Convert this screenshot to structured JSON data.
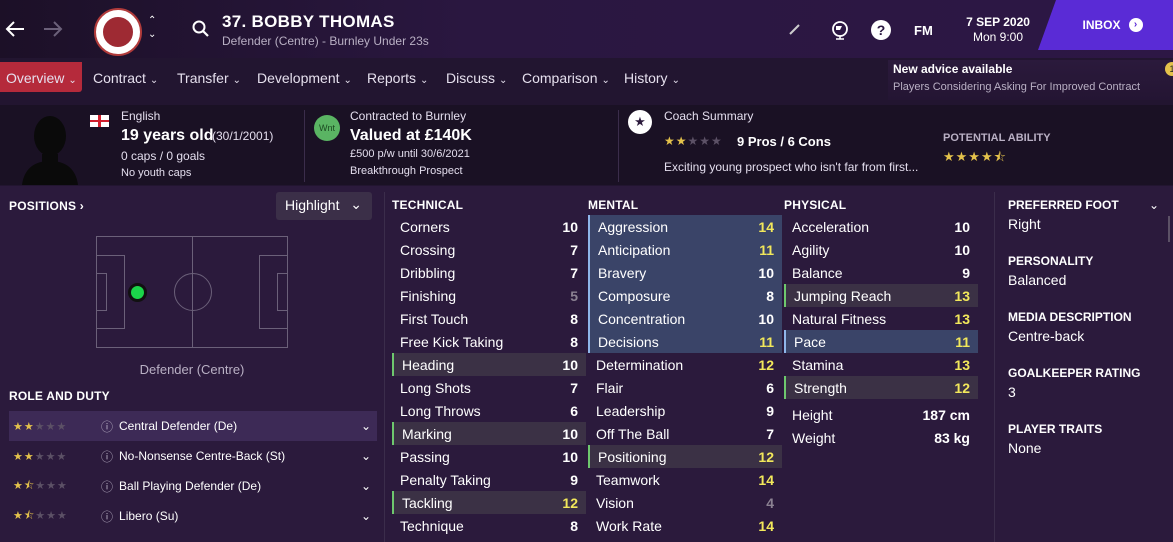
{
  "header": {
    "back_icon": "arrow-left-icon",
    "forward_icon": "arrow-right-icon",
    "player_name": "37. BOBBY THOMAS",
    "player_sub": "Defender (Centre) - Burnley Under 23s",
    "date": "7 SEP 2020",
    "time": "Mon 9:00",
    "fm_label": "FM",
    "inbox_label": "INBOX"
  },
  "menu": [
    {
      "label": "Overview"
    },
    {
      "label": "Contract"
    },
    {
      "label": "Transfer"
    },
    {
      "label": "Development"
    },
    {
      "label": "Reports"
    },
    {
      "label": "Discuss"
    },
    {
      "label": "Comparison"
    },
    {
      "label": "History"
    }
  ],
  "advice": {
    "title": "New advice available",
    "subtitle": "Players Considering Asking For Improved Contract",
    "count": "1"
  },
  "profile": {
    "nationality": "English",
    "age": "19 years old",
    "dob": "(30/1/2001)",
    "caps": "0 caps / 0 goals",
    "youth": "No youth caps"
  },
  "contract": {
    "badge": "Wnt",
    "title": "Contracted to Burnley",
    "value": "Valued at £140K",
    "wage": "£500 p/w until 30/6/2021",
    "status": "Breakthrough Prospect"
  },
  "coach": {
    "title": "Coach Summary",
    "pros_cons": "9 Pros / 6 Cons",
    "summary": "Exciting young prospect who isn't far from first...",
    "stars": 2
  },
  "potential": {
    "label": "POTENTIAL ABILITY",
    "stars": 4.5
  },
  "positions": {
    "title": "POSITIONS",
    "highlight": "Highlight",
    "position": "Defender (Centre)"
  },
  "roles": {
    "title": "ROLE AND DUTY",
    "items": [
      {
        "name": "Central Defender (De)",
        "stars": 2
      },
      {
        "name": "No-Nonsense Centre-Back (St)",
        "stars": 2
      },
      {
        "name": "Ball Playing Defender (De)",
        "stars": 1.5
      },
      {
        "name": "Libero (Su)",
        "stars": 1.5
      }
    ]
  },
  "technical": {
    "title": "TECHNICAL",
    "rows": [
      {
        "n": "Corners",
        "v": "10"
      },
      {
        "n": "Crossing",
        "v": "7"
      },
      {
        "n": "Dribbling",
        "v": "7"
      },
      {
        "n": "Finishing",
        "v": "5"
      },
      {
        "n": "First Touch",
        "v": "8"
      },
      {
        "n": "Free Kick Taking",
        "v": "8"
      },
      {
        "n": "Heading",
        "v": "10"
      },
      {
        "n": "Long Shots",
        "v": "7"
      },
      {
        "n": "Long Throws",
        "v": "6"
      },
      {
        "n": "Marking",
        "v": "10"
      },
      {
        "n": "Passing",
        "v": "10"
      },
      {
        "n": "Penalty Taking",
        "v": "9"
      },
      {
        "n": "Tackling",
        "v": "12"
      },
      {
        "n": "Technique",
        "v": "8"
      }
    ]
  },
  "mental": {
    "title": "MENTAL",
    "rows": [
      {
        "n": "Aggression",
        "v": "14"
      },
      {
        "n": "Anticipation",
        "v": "11"
      },
      {
        "n": "Bravery",
        "v": "10"
      },
      {
        "n": "Composure",
        "v": "8"
      },
      {
        "n": "Concentration",
        "v": "10"
      },
      {
        "n": "Decisions",
        "v": "11"
      },
      {
        "n": "Determination",
        "v": "12"
      },
      {
        "n": "Flair",
        "v": "6"
      },
      {
        "n": "Leadership",
        "v": "9"
      },
      {
        "n": "Off The Ball",
        "v": "7"
      },
      {
        "n": "Positioning",
        "v": "12"
      },
      {
        "n": "Teamwork",
        "v": "14"
      },
      {
        "n": "Vision",
        "v": "4"
      },
      {
        "n": "Work Rate",
        "v": "14"
      }
    ]
  },
  "physical": {
    "title": "PHYSICAL",
    "rows": [
      {
        "n": "Acceleration",
        "v": "10"
      },
      {
        "n": "Agility",
        "v": "10"
      },
      {
        "n": "Balance",
        "v": "9"
      },
      {
        "n": "Jumping Reach",
        "v": "13"
      },
      {
        "n": "Natural Fitness",
        "v": "13"
      },
      {
        "n": "Pace",
        "v": "11"
      },
      {
        "n": "Stamina",
        "v": "13"
      },
      {
        "n": "Strength",
        "v": "12"
      }
    ],
    "height_label": "Height",
    "height": "187 cm",
    "weight_label": "Weight",
    "weight": "83 kg"
  },
  "info": {
    "foot_label": "PREFERRED FOOT",
    "foot": "Right",
    "personality_label": "PERSONALITY",
    "personality": "Balanced",
    "media_label": "MEDIA DESCRIPTION",
    "media": "Centre-back",
    "gk_label": "GOALKEEPER RATING",
    "gk": "3",
    "traits_label": "PLAYER TRAITS",
    "traits": "None"
  },
  "colors": {
    "accent": "#5a2bd6",
    "menu_active": "#b52a3b",
    "star": "#e4c24b",
    "high": "#f2e85b"
  }
}
